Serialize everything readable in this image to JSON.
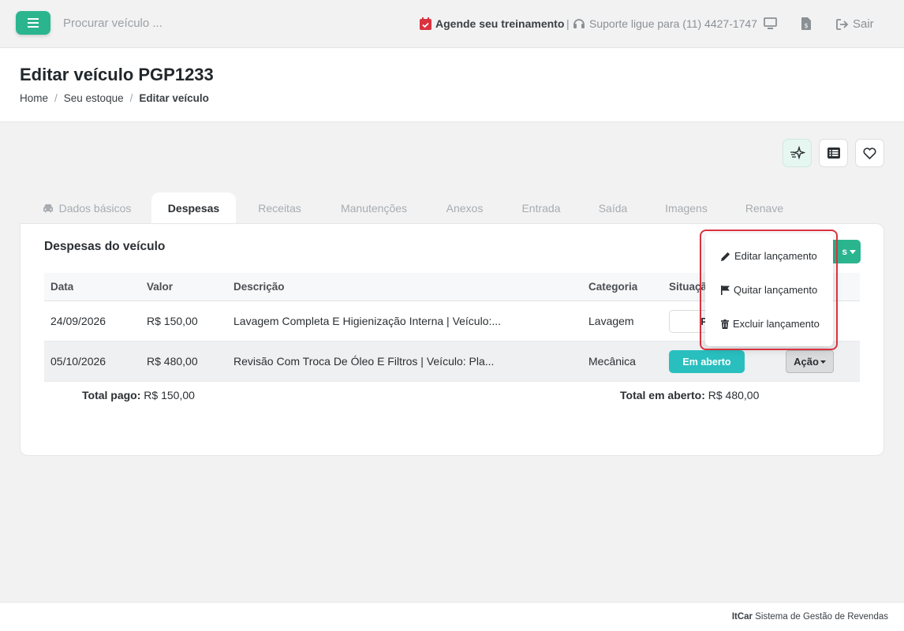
{
  "topbar": {
    "search_placeholder": "Procurar veículo ...",
    "training_label": "Agende seu treinamento",
    "separator": "|",
    "support_label": "Suporte ligue para (11) 4427-1747",
    "exit_label": "Sair"
  },
  "header": {
    "title": "Editar veículo PGP1233",
    "breadcrumb": [
      "Home",
      "Seu estoque",
      "Editar veículo"
    ],
    "breadcrumb_sep": "/"
  },
  "tabs": [
    {
      "label": "Dados básicos"
    },
    {
      "label": "Despesas"
    },
    {
      "label": "Receitas"
    },
    {
      "label": "Manutenções"
    },
    {
      "label": "Anexos"
    },
    {
      "label": "Entrada"
    },
    {
      "label": "Saída"
    },
    {
      "label": "Imagens"
    },
    {
      "label": "Renave"
    }
  ],
  "card": {
    "title": "Despesas do veículo",
    "green_button_label": "s"
  },
  "table": {
    "headers": [
      "Data",
      "Valor",
      "Descrição",
      "Categoria",
      "Situaçã"
    ],
    "rows": [
      {
        "data": "24/09/2026",
        "valor": "R$ 150,00",
        "descricao": "Lavagem Completa E Higienização Interna | Veículo:...",
        "categoria": "Lavagem",
        "situacao": "Pa"
      },
      {
        "data": "05/10/2026",
        "valor": "R$ 480,00",
        "descricao": "Revisão Com Troca De Óleo E Filtros | Veículo: Pla...",
        "categoria": "Mecânica",
        "situacao": "Em aberto",
        "acao": "Ação"
      }
    ]
  },
  "totals": {
    "paid_label": "Total pago:",
    "paid_value": "R$ 150,00",
    "open_label": "Total em aberto:",
    "open_value": "R$ 480,00"
  },
  "dropdown": {
    "items": [
      {
        "label": "Editar lançamento",
        "icon": "pencil-icon"
      },
      {
        "label": "Quitar lançamento",
        "icon": "flag-icon"
      },
      {
        "label": "Excluir lançamento",
        "icon": "trash-icon"
      }
    ]
  },
  "footer": {
    "brand": "ItCar",
    "text": "Sistema de Gestão de Revendas"
  },
  "colors": {
    "accent": "#2bb58f",
    "status_open": "#29bfbf",
    "highlight": "#d9333f"
  }
}
